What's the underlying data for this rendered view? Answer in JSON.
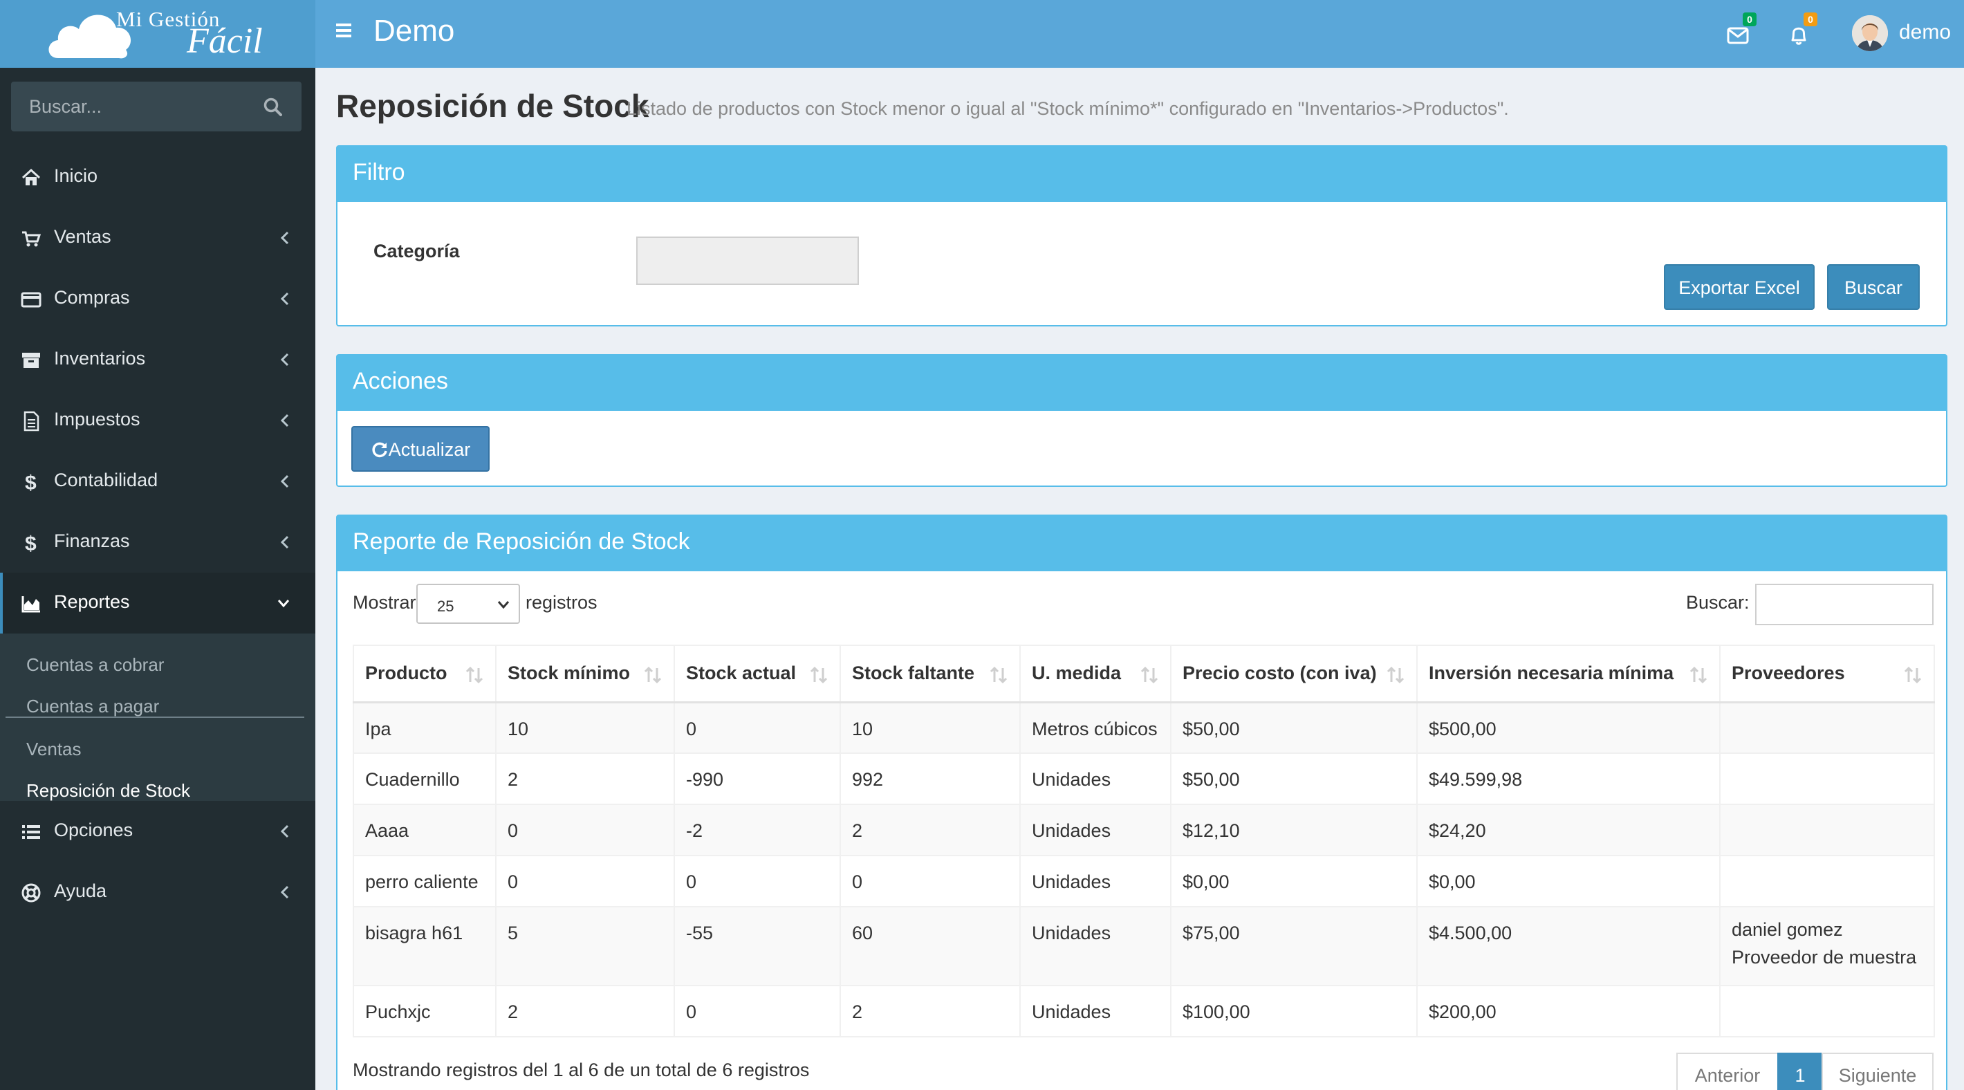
{
  "app": {
    "logo_line1": "Mi Gestión",
    "logo_line2": "Fácil",
    "title": "Demo",
    "mail_count": "0",
    "notif_count": "0",
    "username": "demo"
  },
  "sidebar": {
    "search_placeholder": "Buscar...",
    "items": [
      {
        "label": "Inicio",
        "icon": "home-icon"
      },
      {
        "label": "Ventas",
        "icon": "cart-icon"
      },
      {
        "label": "Compras",
        "icon": "credit-card-icon"
      },
      {
        "label": "Inventarios",
        "icon": "archive-icon"
      },
      {
        "label": "Impuestos",
        "icon": "document-icon"
      },
      {
        "label": "Contabilidad",
        "icon": "dollar-icon"
      },
      {
        "label": "Finanzas",
        "icon": "dollar-icon"
      },
      {
        "label": "Reportes",
        "icon": "area-chart-icon"
      },
      {
        "label": "Opciones",
        "icon": "list-icon"
      },
      {
        "label": "Ayuda",
        "icon": "life-ring-icon"
      }
    ],
    "submenu": [
      "Cuentas a cobrar",
      "Cuentas a pagar",
      "Ventas",
      "Reposición de Stock"
    ]
  },
  "page": {
    "title": "Reposición de Stock",
    "subtitle": "Listado de productos con Stock menor o igual al \"Stock mínimo*\" configurado en \"Inventarios->Productos\"."
  },
  "filter": {
    "header": "Filtro",
    "category_label": "Categoría",
    "export_label": "Exportar Excel",
    "search_label": "Buscar"
  },
  "actions": {
    "header": "Acciones",
    "update_label": "Actualizar"
  },
  "report": {
    "header": "Reporte de Reposición de Stock",
    "show_label": "Mostrar",
    "page_size": "25",
    "records_label": "registros",
    "search_label": "Buscar:",
    "columns": [
      "Producto",
      "Stock mínimo",
      "Stock actual",
      "Stock faltante",
      "U. medida",
      "Precio costo (con iva)",
      "Inversión necesaria mínima",
      "Proveedores"
    ],
    "rows": [
      {
        "producto": "Ipa",
        "stock_minimo": "10",
        "stock_actual": "0",
        "stock_faltante": "10",
        "unidad": "Metros cúbicos",
        "precio": "$50,00",
        "inversion": "$500,00",
        "proveedores": [
          "",
          ""
        ]
      },
      {
        "producto": "Cuadernillo",
        "stock_minimo": "2",
        "stock_actual": "-990",
        "stock_faltante": "992",
        "unidad": "Unidades",
        "precio": "$50,00",
        "inversion": "$49.599,98",
        "proveedores": [
          "",
          ""
        ]
      },
      {
        "producto": "Aaaa",
        "stock_minimo": "0",
        "stock_actual": "-2",
        "stock_faltante": "2",
        "unidad": "Unidades",
        "precio": "$12,10",
        "inversion": "$24,20",
        "proveedores": [
          "",
          ""
        ]
      },
      {
        "producto": "perro caliente",
        "stock_minimo": "0",
        "stock_actual": "0",
        "stock_faltante": "0",
        "unidad": "Unidades",
        "precio": "$0,00",
        "inversion": "$0,00",
        "proveedores": [
          "",
          ""
        ]
      },
      {
        "producto": "bisagra h61",
        "stock_minimo": "5",
        "stock_actual": "-55",
        "stock_faltante": "60",
        "unidad": "Unidades",
        "precio": "$75,00",
        "inversion": "$4.500,00",
        "proveedores": [
          "daniel gomez",
          "Proveedor de muestra"
        ]
      },
      {
        "producto": "Puchxjc",
        "stock_minimo": "2",
        "stock_actual": "0",
        "stock_faltante": "2",
        "unidad": "Unidades",
        "precio": "$100,00",
        "inversion": "$200,00",
        "proveedores": [
          "",
          ""
        ]
      }
    ],
    "info": "Mostrando registros del 1 al 6 de un total de 6 registros",
    "pagination": {
      "prev": "Anterior",
      "current": "1",
      "next": "Siguiente"
    }
  },
  "colors": {
    "header_bg": "#5aa7d9",
    "logo_bg": "#4f9ecf",
    "sidebar_bg": "#222d32",
    "box_header": "#57bde9",
    "primary": "#3c8dbc"
  }
}
